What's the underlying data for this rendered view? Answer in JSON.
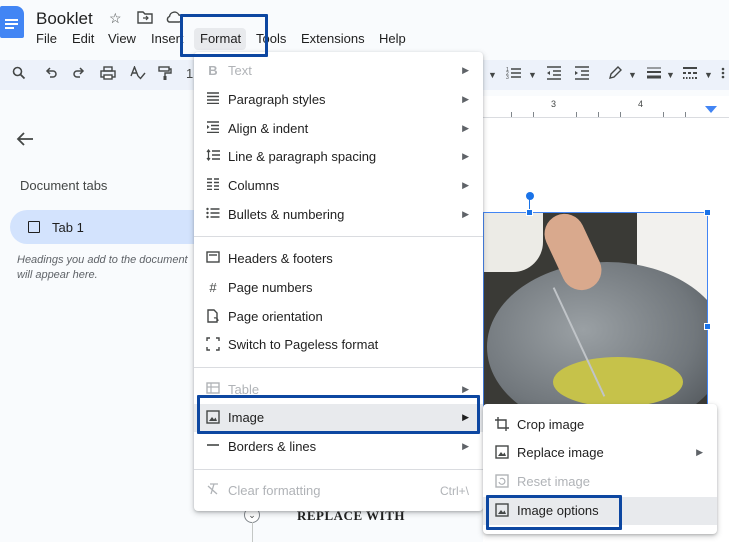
{
  "header": {
    "title": "Booklet",
    "icons": [
      "star-icon",
      "move-folder-icon",
      "cloud-status-icon"
    ]
  },
  "menubar": {
    "items": [
      "File",
      "Edit",
      "View",
      "Insert",
      "Format",
      "Tools",
      "Extensions",
      "Help"
    ]
  },
  "toolbar": {
    "left_icons": [
      "search-icon",
      "undo-icon",
      "redo-icon",
      "print-icon",
      "spellcheck-icon",
      "paint-format-icon"
    ],
    "right_icons": [
      "bulleted-list-icon",
      "numbered-list-icon",
      "decrease-indent-icon",
      "increase-indent-icon",
      "pen-icon",
      "border-weight-icon",
      "border-dash-icon"
    ]
  },
  "ruler": {
    "numbers": [
      "3",
      "4"
    ]
  },
  "left_pane": {
    "heading": "Document tabs",
    "tab_label": "Tab 1",
    "hint": "Headings you add to the document will appear here."
  },
  "document": {
    "body_text": "REPLACE WITH"
  },
  "format_menu": {
    "items": [
      {
        "label": "Text",
        "icon": "bold-icon",
        "submenu": true,
        "disabled": true
      },
      {
        "label": "Paragraph styles",
        "icon": "paragraph-styles-icon",
        "submenu": true
      },
      {
        "label": "Align & indent",
        "icon": "align-indent-icon",
        "submenu": true
      },
      {
        "label": "Line & paragraph spacing",
        "icon": "line-spacing-icon",
        "submenu": true
      },
      {
        "label": "Columns",
        "icon": "columns-icon",
        "submenu": true
      },
      {
        "label": "Bullets & numbering",
        "icon": "bullets-icon",
        "submenu": true
      },
      {
        "label": "Headers & footers",
        "icon": "headers-footers-icon"
      },
      {
        "label": "Page numbers",
        "icon": "hash-icon"
      },
      {
        "label": "Page orientation",
        "icon": "page-orientation-icon"
      },
      {
        "label": "Switch to Pageless format",
        "icon": "pageless-icon"
      },
      {
        "label": "Table",
        "icon": "table-icon",
        "submenu": true,
        "disabled": true
      },
      {
        "label": "Image",
        "icon": "image-icon",
        "submenu": true,
        "active": true
      },
      {
        "label": "Borders & lines",
        "icon": "borders-lines-icon",
        "submenu": true
      },
      {
        "label": "Clear formatting",
        "icon": "clear-formatting-icon",
        "shortcut": "Ctrl+\\",
        "disabled": true
      }
    ]
  },
  "image_submenu": {
    "items": [
      {
        "label": "Crop image",
        "icon": "crop-icon"
      },
      {
        "label": "Replace image",
        "icon": "image-icon",
        "submenu": true
      },
      {
        "label": "Reset image",
        "icon": "reset-image-icon",
        "disabled": true
      },
      {
        "label": "Image options",
        "icon": "image-icon",
        "active": true
      }
    ]
  },
  "colors": {
    "accent": "#1a73e8",
    "highlight_box": "#0d47a1",
    "tab_pill": "#d3e3fd",
    "menu_hover": "#e8eaed"
  }
}
